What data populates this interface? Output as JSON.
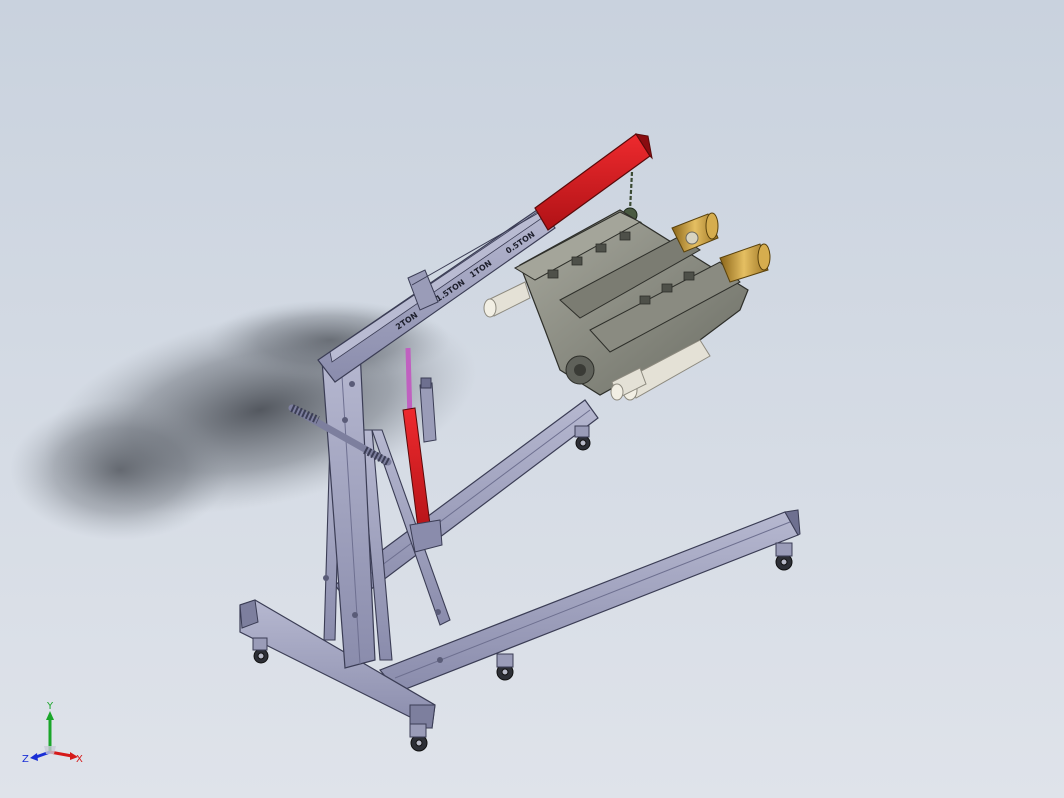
{
  "viewport": {
    "background_top": "#c9d2de",
    "background_bottom": "#dfe3ea"
  },
  "model": {
    "boom_labels": [
      "2TON",
      "1.5TON",
      "1TON",
      "0.5TON"
    ],
    "colors": {
      "frame": "#9a9cb8",
      "frame_dark": "#6e7090",
      "boom_red": "#d0181c",
      "cylinder_red": "#b81418",
      "engine": "#8a8c84",
      "engine_dark": "#5f615a",
      "exhaust": "#e4e1d6",
      "air_filter": "#c89c3c",
      "chain": "#3a4a32"
    }
  },
  "triad": {
    "x_label": "X",
    "y_label": "Y",
    "z_label": "Z",
    "x_color": "#d61a1a",
    "y_color": "#1aa62a",
    "z_color": "#1a2fd6"
  }
}
